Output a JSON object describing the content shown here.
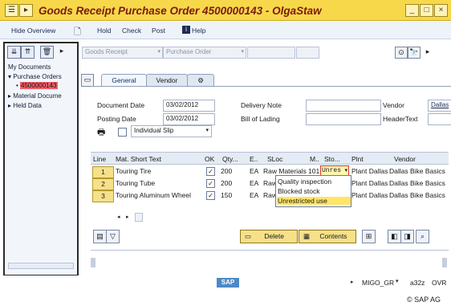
{
  "window": {
    "title": "Goods Receipt Purchase Order 4500000143 - OlgaStaw"
  },
  "menu": {
    "items": [
      "Hide Overview",
      "Hold",
      "Check",
      "Post",
      "Help"
    ]
  },
  "left_pane": {
    "root": "My Documents",
    "nodes": [
      "Purchase Orders",
      "4500000143",
      "Material Docume",
      "Held Data"
    ]
  },
  "header_toolbar": {
    "action": "Goods Receipt",
    "reference": "Purchase Order"
  },
  "tabs": [
    "General",
    "Vendor"
  ],
  "general": {
    "document_date_label": "Document Date",
    "document_date": "03/02/2012",
    "posting_date_label": "Posting Date",
    "posting_date": "03/02/2012",
    "delivery_note_label": "Delivery Note",
    "delivery_note": "",
    "bill_of_lading_label": "Bill of Lading",
    "bill_of_lading": "",
    "vendor_label": "Vendor",
    "vendor": "Dallas",
    "header_text_label": "HeaderText",
    "header_text": "",
    "slip_option": "Individual Slip"
  },
  "table": {
    "columns": [
      "Line",
      "Mat. Short Text",
      "OK",
      "Qty...",
      "E..",
      "SLoc",
      "M..",
      "Sto...",
      "Plnt",
      "Vendor"
    ],
    "rows": [
      {
        "line": "1",
        "text": "Touring Tire",
        "ok": "✓",
        "qty": "200",
        "unit": "EA",
        "sloc": "Raw Materials",
        "mvt": "101",
        "stock": "Unres",
        "plant": "Plant Dallas",
        "vendor": "Dallas Bike Basics"
      },
      {
        "line": "2",
        "text": "Touring Tube",
        "ok": "✓",
        "qty": "200",
        "unit": "EA",
        "sloc": "Raw",
        "mvt": "",
        "stock": "",
        "plant": "Plant Dallas",
        "vendor": "Dallas Bike Basics"
      },
      {
        "line": "3",
        "text": "Touring Aluminum Wheel",
        "ok": "✓",
        "qty": "150",
        "unit": "EA",
        "sloc": "Raw",
        "mvt": "",
        "stock": "",
        "plant": "Plant Dallas",
        "vendor": "Dallas Bike Basics"
      }
    ]
  },
  "stock_dropdown": {
    "options": [
      "Quality inspection",
      "Blocked stock",
      "Unrestricted use"
    ],
    "selected_index": 2
  },
  "bottom_toolbar": {
    "delete": "Delete",
    "contents": "Contents"
  },
  "status": {
    "logo": "SAP",
    "transaction": "MIGO_GR",
    "server": "a32z",
    "mode": "OVR"
  },
  "copyright": "© SAP AG",
  "colors": {
    "title_bar": "#f7d84a",
    "title_text": "#7a1b10",
    "highlight": "#f7e08a",
    "selected_node": "#f0606a",
    "dropdown_selected": "#ffe566"
  }
}
